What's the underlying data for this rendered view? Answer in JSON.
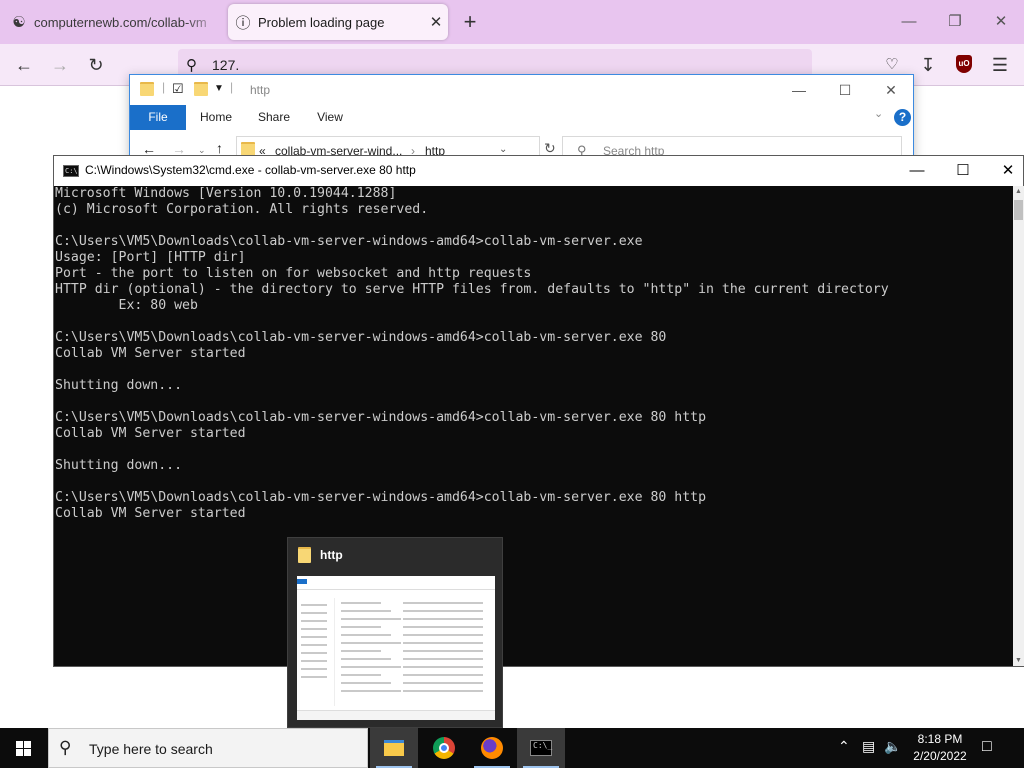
{
  "firefox": {
    "tabs": [
      {
        "title": "computernewb.com/collab-vm",
        "icon": "user-globe-icon",
        "active": false
      },
      {
        "title": "Problem loading page",
        "icon": "info-circle-icon",
        "active": true
      }
    ],
    "url": "127.",
    "colors": {
      "tabbar": "#e8c5ef",
      "navbar": "#f6e8f8",
      "urlbar": "#eed6f1"
    }
  },
  "explorer": {
    "title": "http",
    "ribbon_tabs": [
      "File",
      "Home",
      "Share",
      "View"
    ],
    "breadcrumb": [
      "collab-vm-server-wind...",
      "http"
    ],
    "crumb_prefix": "«",
    "search_placeholder": "Search http",
    "help": "?"
  },
  "cmd": {
    "title": "C:\\Windows\\System32\\cmd.exe - collab-vm-server.exe 80 http",
    "lines": [
      "Microsoft Windows [Version 10.0.19044.1288]",
      "(c) Microsoft Corporation. All rights reserved.",
      "",
      "C:\\Users\\VM5\\Downloads\\collab-vm-server-windows-amd64>collab-vm-server.exe",
      "Usage: [Port] [HTTP dir]",
      "Port - the port to listen on for websocket and http requests",
      "HTTP dir (optional) - the directory to serve HTTP files from. defaults to \"http\" in the current directory",
      "        Ex: 80 web",
      "",
      "C:\\Users\\VM5\\Downloads\\collab-vm-server-windows-amd64>collab-vm-server.exe 80",
      "Collab VM Server started",
      "",
      "Shutting down...",
      "",
      "C:\\Users\\VM5\\Downloads\\collab-vm-server-windows-amd64>collab-vm-server.exe 80 http",
      "Collab VM Server started",
      "",
      "Shutting down...",
      "",
      "C:\\Users\\VM5\\Downloads\\collab-vm-server-windows-amd64>collab-vm-server.exe 80 http",
      "Collab VM Server started"
    ]
  },
  "thumbnail": {
    "title": "http"
  },
  "taskbar": {
    "search_placeholder": "Type here to search",
    "apps": [
      "file-explorer-icon",
      "chrome-icon",
      "firefox-icon",
      "cmd-icon"
    ],
    "active_app": "cmd-icon",
    "time": "8:18 PM",
    "date": "2/20/2022"
  }
}
